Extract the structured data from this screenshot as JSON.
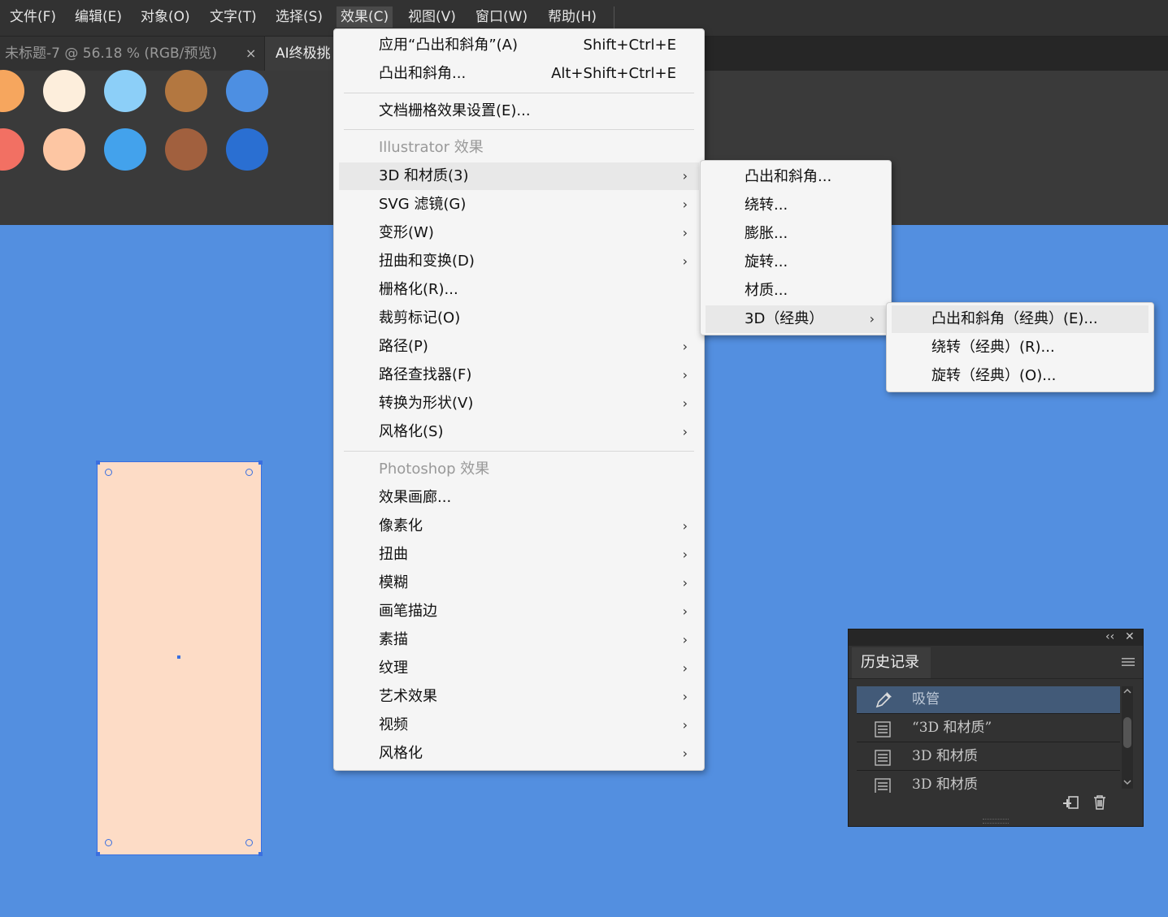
{
  "menubar": {
    "items": [
      "文件(F)",
      "编辑(E)",
      "对象(O)",
      "文字(T)",
      "选择(S)",
      "效果(C)",
      "视图(V)",
      "窗口(W)",
      "帮助(H)"
    ]
  },
  "tabs": {
    "doc1": "未标题-7 @ 56.18 % (RGB/预览)",
    "doc1_close": "×",
    "doc2": "AI终极挑"
  },
  "swatches": {
    "row1": [
      "#f6a65e",
      "#fdeedc",
      "#8ccff8",
      "#b37740",
      "#4d8fe2"
    ],
    "row2": [
      "#f27063",
      "#fdc6a3",
      "#43a2ec",
      "#a1603e",
      "#2a6fd2"
    ]
  },
  "effect_menu": {
    "apply_last": "应用“凸出和斜角”(A)",
    "apply_last_shortcut": "Shift+Ctrl+E",
    "last_effect": "凸出和斜角...",
    "last_effect_shortcut": "Alt+Shift+Ctrl+E",
    "doc_raster": "文档栅格效果设置(E)...",
    "illustrator_header": "Illustrator 效果",
    "illustrator_items": [
      "3D 和材质(3)",
      "SVG 滤镜(G)",
      "变形(W)",
      "扭曲和变换(D)",
      "栅格化(R)...",
      "裁剪标记(O)",
      "路径(P)",
      "路径查找器(F)",
      "转换为形状(V)",
      "风格化(S)"
    ],
    "photoshop_header": "Photoshop 效果",
    "photoshop_items": [
      "效果画廊...",
      "像素化",
      "扭曲",
      "模糊",
      "画笔描边",
      "素描",
      "纹理",
      "艺术效果",
      "视频",
      "风格化"
    ],
    "arrow": "›"
  },
  "submenu_3d": {
    "items": [
      "凸出和斜角...",
      "绕转...",
      "膨胀...",
      "旋转...",
      "材质...",
      "3D（经典）"
    ]
  },
  "submenu_classic": {
    "items": [
      "凸出和斜角（经典）(E)...",
      "绕转（经典）(R)...",
      "旋转（经典）(O)..."
    ]
  },
  "history_panel": {
    "title": "历史记录",
    "collapse": "‹‹",
    "close": "✕",
    "rows": [
      "吸管",
      "“3D 和材质”",
      "3D 和材质",
      "3D 和材质"
    ]
  },
  "colors": {
    "canvas": "#538fe0",
    "shape_fill": "#fddcc6",
    "selection": "#3a6fe0"
  }
}
